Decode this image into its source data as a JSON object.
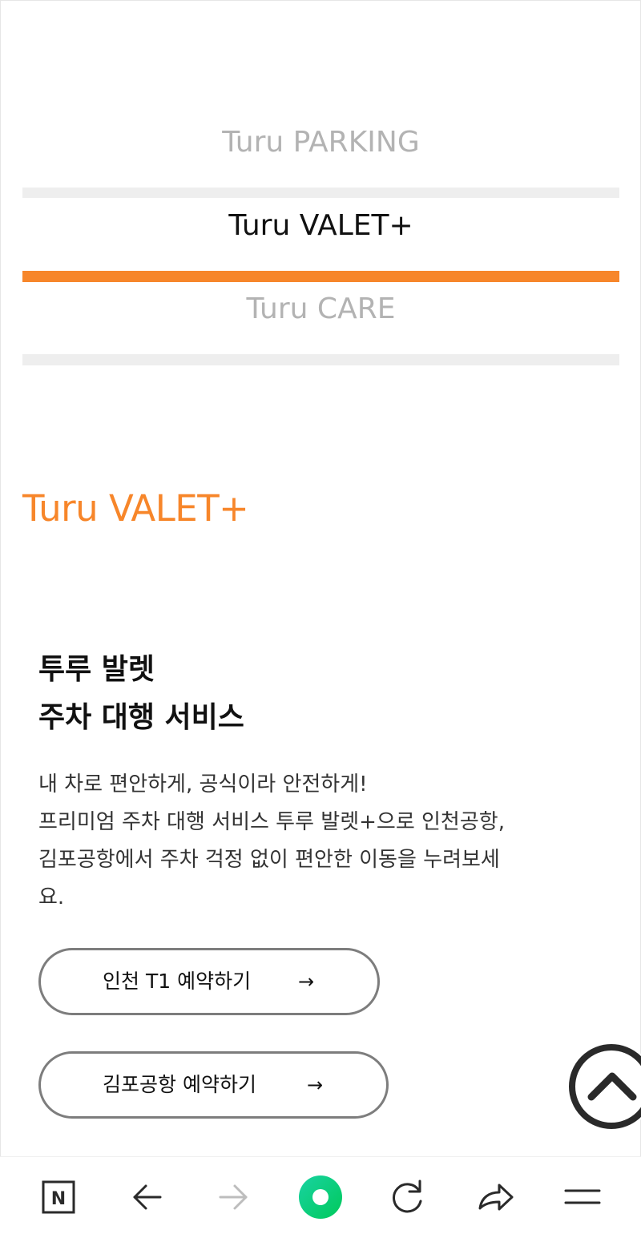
{
  "tabs": [
    {
      "label": "Turu PARKING",
      "active": false
    },
    {
      "label": "Turu VALET+",
      "active": true
    },
    {
      "label": "Turu CARE",
      "active": false
    }
  ],
  "section": {
    "title": "Turu VALET+"
  },
  "service": {
    "title_lines": [
      "투루 발렛",
      "주차 대행 서비스"
    ],
    "description_lines": [
      "내 차로 편안하게, 공식이라 안전하게!",
      "프리미엄 주차 대행 서비스 투루 발렛+으로 인천공항,",
      "김포공항에서 주차 걱정 없이 편안한 이동을 누려보세",
      "요."
    ]
  },
  "buttons": {
    "incheon": {
      "label": "인천 T1 예약하기",
      "arrow": "→"
    },
    "gimpo": {
      "label": "김포공항 예약하기",
      "arrow": "→"
    }
  },
  "toolbar": {
    "home_letter": "N",
    "icons": [
      "naver-home-icon",
      "back-arrow-icon",
      "forward-arrow-icon",
      "green-dot-icon",
      "refresh-icon",
      "share-icon",
      "menu-icon"
    ]
  },
  "colors": {
    "accent": "#f7862a",
    "inactive_tab": "#b3b3b3",
    "tab_divider": "#eeeeee",
    "green": "#1ed760"
  }
}
